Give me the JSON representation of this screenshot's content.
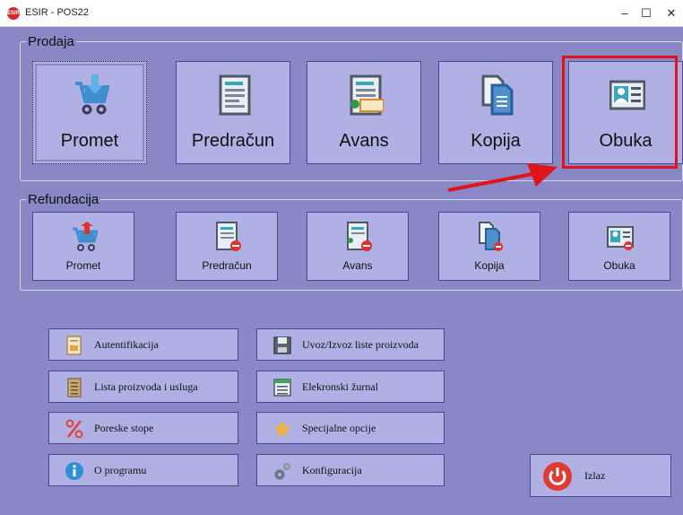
{
  "window": {
    "title": "ESIR - POS22",
    "icon_text": "ESIR",
    "minimize": "–",
    "maximize": "☐",
    "close": "✕"
  },
  "prodaja": {
    "legend": "Prodaja",
    "tiles": [
      {
        "label": "Promet",
        "icon": "cart-download-icon"
      },
      {
        "label": "Predračun",
        "icon": "document-icon"
      },
      {
        "label": "Avans",
        "icon": "document-money-icon"
      },
      {
        "label": "Kopija",
        "icon": "copy-icon"
      },
      {
        "label": "Obuka",
        "icon": "id-card-icon"
      }
    ]
  },
  "refundacija": {
    "legend": "Refundacija",
    "tiles": [
      {
        "label": "Promet",
        "icon": "cart-return-icon"
      },
      {
        "label": "Predračun",
        "icon": "document-cancel-icon"
      },
      {
        "label": "Avans",
        "icon": "document-cancel-icon"
      },
      {
        "label": "Kopija",
        "icon": "copy-cancel-icon"
      },
      {
        "label": "Obuka",
        "icon": "id-card-cancel-icon"
      }
    ]
  },
  "commands": {
    "left": [
      {
        "label": "Autentifikacija",
        "icon": "certificate-icon"
      },
      {
        "label": "Lista proizvoda i usluga",
        "icon": "list-icon"
      },
      {
        "label": "Poreske stope",
        "icon": "percent-icon"
      },
      {
        "label": "O programu",
        "icon": "info-icon"
      }
    ],
    "right": [
      {
        "label": "Uvoz/Izvoz liste proizvoda",
        "icon": "floppy-icon"
      },
      {
        "label": "Elekronski žurnal",
        "icon": "journal-icon"
      },
      {
        "label": "Specijalne opcije",
        "icon": "star-icon"
      },
      {
        "label": "Konfiguracija",
        "icon": "gears-icon"
      }
    ]
  },
  "exit": {
    "label": "Izlaz",
    "icon": "power-icon"
  },
  "annotation": {
    "highlight_color": "#e0141b",
    "highlighted": "Obuka"
  },
  "colors": {
    "background": "#8a87c7",
    "tile": "#b1b0e4",
    "tile_border": "#4a4896"
  }
}
